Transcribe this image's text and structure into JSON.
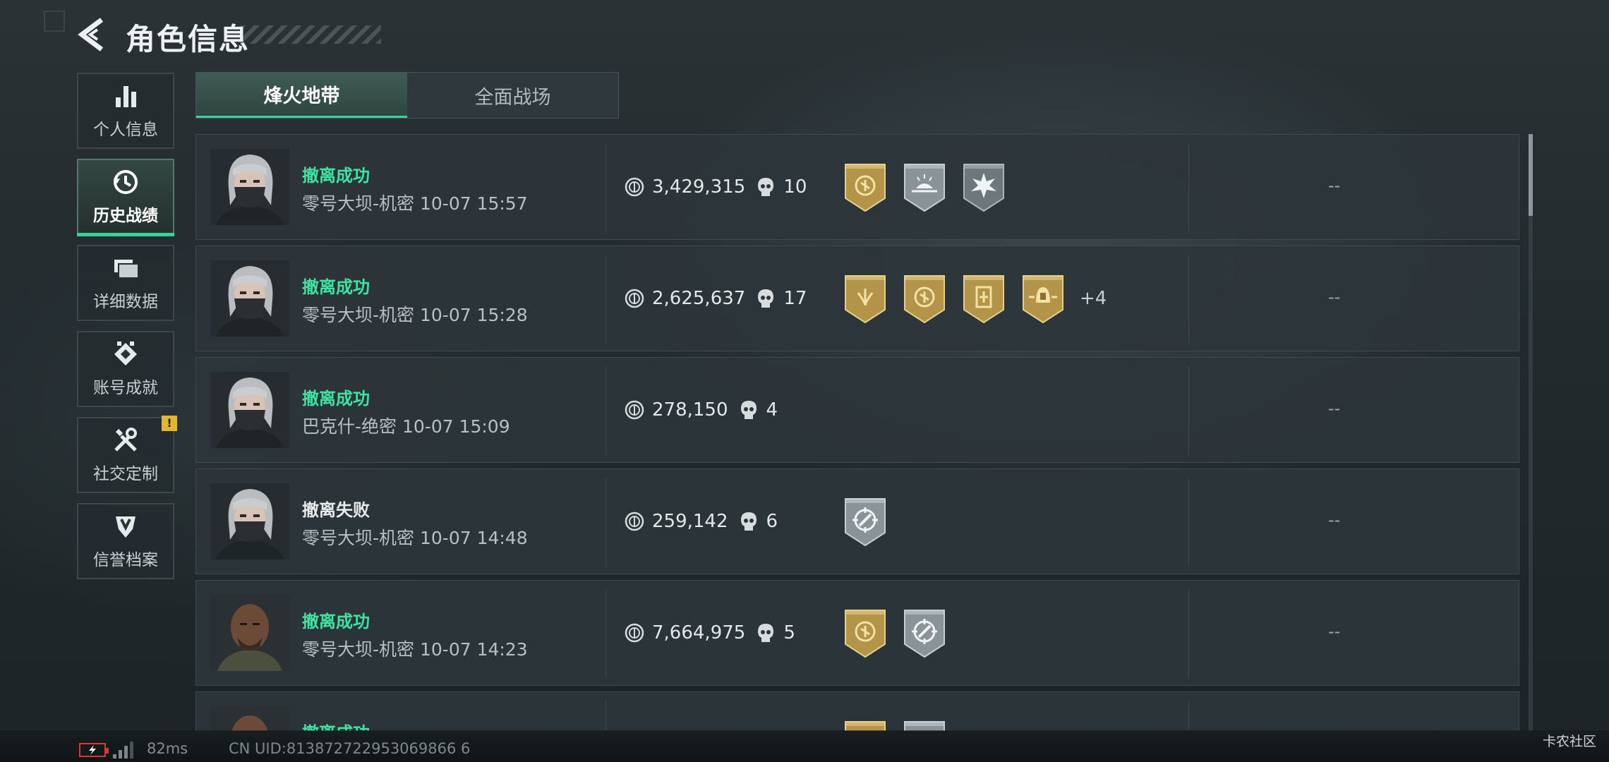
{
  "header": {
    "title": "角色信息"
  },
  "sidebar": {
    "items": [
      {
        "label": "个人信息",
        "icon": "bar-chart-icon",
        "active": false
      },
      {
        "label": "历史战绩",
        "icon": "history-clock-icon",
        "active": true
      },
      {
        "label": "详细数据",
        "icon": "folders-icon",
        "active": false
      },
      {
        "label": "账号成就",
        "icon": "achievement-icon",
        "active": false
      },
      {
        "label": "社交定制",
        "icon": "tools-icon",
        "active": false,
        "badge": "!"
      },
      {
        "label": "信誉档案",
        "icon": "reputation-shield-icon",
        "active": false
      }
    ]
  },
  "tabs": [
    {
      "label": "烽火地带",
      "active": true
    },
    {
      "label": "全面战场",
      "active": false
    }
  ],
  "records": [
    {
      "status": "撤离成功",
      "success": true,
      "map": "零号大坝-机密",
      "time": "10-07 15:57",
      "value": "3,429,315",
      "kills": "10",
      "badges": [
        "gold-coin-badge",
        "silver-sunrise-badge",
        "silver-burst-badge"
      ],
      "more": "",
      "extra": "--",
      "portrait": "female-masked"
    },
    {
      "status": "撤离成功",
      "success": true,
      "map": "零号大坝-机密",
      "time": "10-07 15:28",
      "value": "2,625,637",
      "kills": "17",
      "badges": [
        "gold-laurel-badge",
        "gold-coin-badge",
        "gold-card-badge",
        "gold-helmet-badge"
      ],
      "more": "+4",
      "extra": "--",
      "portrait": "female-masked"
    },
    {
      "status": "撤离成功",
      "success": true,
      "map": "巴克什-绝密",
      "time": "10-07 15:09",
      "value": "278,150",
      "kills": "4",
      "badges": [],
      "more": "",
      "extra": "--",
      "portrait": "female-masked"
    },
    {
      "status": "撤离失败",
      "success": false,
      "map": "零号大坝-机密",
      "time": "10-07 14:48",
      "value": "259,142",
      "kills": "6",
      "badges": [
        "silver-crosshair-badge"
      ],
      "more": "",
      "extra": "--",
      "portrait": "female-masked"
    },
    {
      "status": "撤离成功",
      "success": true,
      "map": "零号大坝-机密",
      "time": "10-07 14:23",
      "value": "7,664,975",
      "kills": "5",
      "badges": [
        "gold-coin-badge",
        "silver-crosshair-badge"
      ],
      "more": "",
      "extra": "--",
      "portrait": "male-bald"
    },
    {
      "status": "撤离成功",
      "success": true,
      "map": "",
      "time": "",
      "value": "",
      "kills": "",
      "badges": [
        "gold-coin-badge",
        "silver-sunrise-badge"
      ],
      "more": "",
      "extra": "",
      "portrait": "male-bald"
    }
  ],
  "footer": {
    "ping": "82ms",
    "uid": "CN UID:813872722953069866 6",
    "watermark": "卡农社区"
  },
  "colors": {
    "accent": "#36d29a",
    "success": "#3ee3a3",
    "gold": "#b39449",
    "silver": "#8a9498",
    "battery": "#d8383a"
  }
}
